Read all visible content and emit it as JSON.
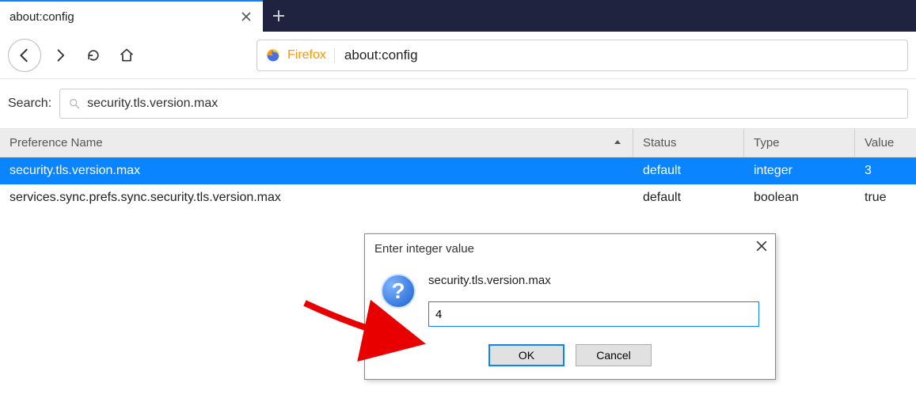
{
  "tab": {
    "title": "about:config"
  },
  "urlbar": {
    "brand": "Firefox",
    "url": "about:config"
  },
  "search": {
    "label": "Search:",
    "value": "security.tls.version.max"
  },
  "columns": {
    "name": "Preference Name",
    "status": "Status",
    "type": "Type",
    "value": "Value"
  },
  "rows": [
    {
      "name": "security.tls.version.max",
      "status": "default",
      "type": "integer",
      "value": "3"
    },
    {
      "name": "services.sync.prefs.sync.security.tls.version.max",
      "status": "default",
      "type": "boolean",
      "value": "true"
    }
  ],
  "dialog": {
    "title": "Enter integer value",
    "pref": "security.tls.version.max",
    "input": "4",
    "ok": "OK",
    "cancel": "Cancel"
  }
}
